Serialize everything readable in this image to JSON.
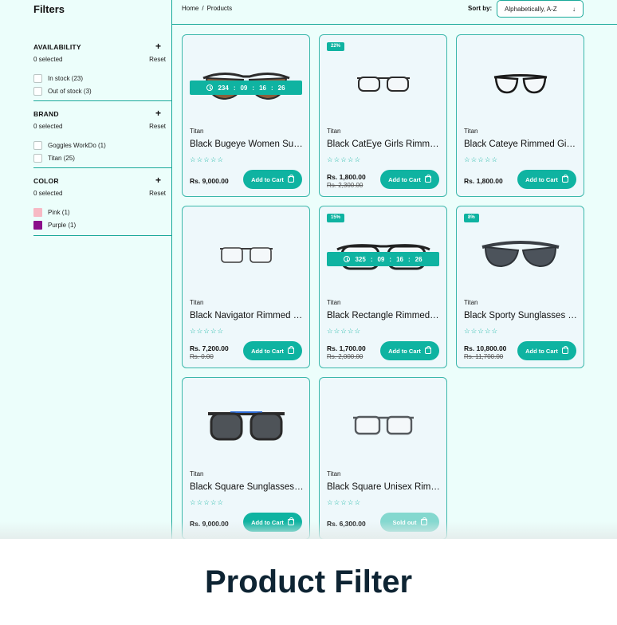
{
  "filters": {
    "title": "Filters",
    "groups": [
      {
        "title": "AVAILABILITY",
        "selected": "0 selected",
        "reset": "Reset",
        "options": [
          {
            "label": "In stock (23)"
          },
          {
            "label": "Out of stock (3)"
          }
        ]
      },
      {
        "title": "BRAND",
        "selected": "0 selected",
        "reset": "Reset",
        "options": [
          {
            "label": "Goggles WorkDo (1)"
          },
          {
            "label": "Titan (25)"
          }
        ]
      },
      {
        "title": "COLOR",
        "selected": "0 selected",
        "reset": "Reset",
        "options": [
          {
            "label": "Pink (1)",
            "color": "#f7b9c4"
          },
          {
            "label": "Purple (1)",
            "color": "#8a0e8a"
          }
        ]
      }
    ]
  },
  "breadcrumb": {
    "home": "Home",
    "sep": "/",
    "current": "Products"
  },
  "sort": {
    "label": "Sort by:",
    "value": "Alphabetically, A-Z"
  },
  "products": [
    {
      "brand": "Titan",
      "name": "Black Bugeye Women Sunglasses",
      "price": "Rs. 9,000.00",
      "old_price": "",
      "badge": "",
      "timer": [
        "234",
        "09",
        "16",
        "26"
      ],
      "button": "Add to Cart"
    },
    {
      "brand": "Titan",
      "name": "Black CatEye Girls Rimmed Eyeglasses",
      "price": "Rs. 1,800.00",
      "old_price": "Rs. 2,300.00",
      "badge": "22%",
      "timer": [],
      "button": "Add to Cart"
    },
    {
      "brand": "Titan",
      "name": "Black Cateye Rimmed Girls Eyeglasses",
      "price": "Rs. 1,800.00",
      "old_price": "",
      "badge": "",
      "timer": [],
      "button": "Add to Cart"
    },
    {
      "brand": "Titan",
      "name": "Black Navigator Rimmed Eyeglasses",
      "price": "Rs. 7,200.00",
      "old_price": "Rs. 0.00",
      "badge": "",
      "timer": [],
      "button": "Add to Cart"
    },
    {
      "brand": "Titan",
      "name": "Black Rectangle Rimmed Eyeglasses",
      "price": "Rs. 1,700.00",
      "old_price": "Rs. 2,000.00",
      "badge": "15%",
      "timer": [
        "325",
        "09",
        "16",
        "26"
      ],
      "button": "Add to Cart"
    },
    {
      "brand": "Titan",
      "name": "Black Sporty Sunglasses for Men",
      "price": "Rs. 10,800.00",
      "old_price": "Rs. 11,700.00",
      "badge": "8%",
      "timer": [],
      "button": "Add to Cart"
    },
    {
      "brand": "Titan",
      "name": "Black Square Sunglasses for Men",
      "price": "Rs. 9,000.00",
      "old_price": "",
      "badge": "",
      "timer": [],
      "button": "Add to Cart"
    },
    {
      "brand": "Titan",
      "name": "Black Square Unisex Rimmed Eyeglasses",
      "price": "Rs. 6,300.00",
      "old_price": "",
      "badge": "",
      "timer": [],
      "button": "Sold out"
    }
  ],
  "icons": {
    "plus": "+",
    "sort_arrow": "↓",
    "star": "☆☆☆☆☆"
  },
  "colors": {
    "accent": "#0fb3a1",
    "background": "#ecfefb",
    "heading": "#0e2433"
  },
  "footer": {
    "title": "Product Filter"
  }
}
